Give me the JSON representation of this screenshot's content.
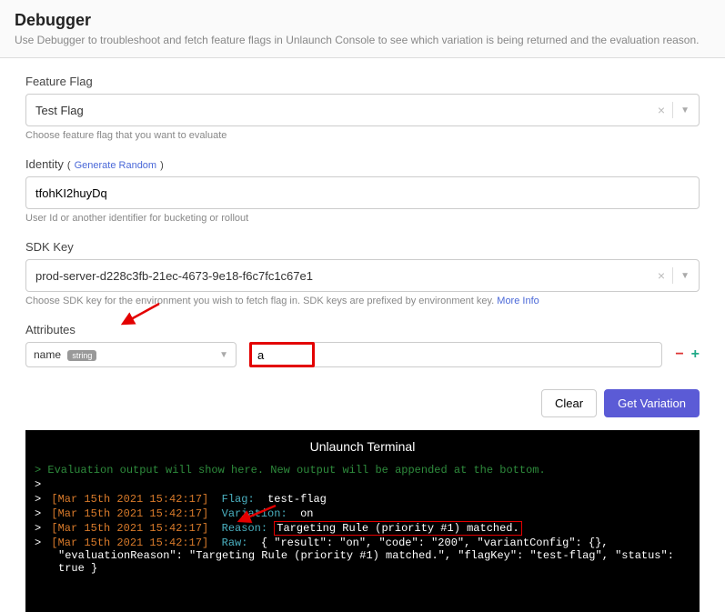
{
  "header": {
    "title": "Debugger",
    "subtitle": "Use Debugger to troubleshoot and fetch feature flags in Unlaunch Console to see which variation is being returned and the evaluation reason."
  },
  "flag": {
    "label": "Feature Flag",
    "value": "Test Flag",
    "help": "Choose feature flag that you want to evaluate"
  },
  "identity": {
    "label": "Identity",
    "generate": "Generate Random",
    "value": "tfohKI2huyDq",
    "help": "User Id or another identifier for bucketing or rollout"
  },
  "sdk": {
    "label": "SDK Key",
    "value": "prod-server-d228c3fb-21ec-4673-9e18-f6c7fc1c67e1",
    "help": "Choose SDK key for the environment you wish to fetch flag in. SDK keys are prefixed by environment key.",
    "more": "More Info"
  },
  "attrs": {
    "label": "Attributes",
    "name": "name",
    "type_badge": "string",
    "value": "a"
  },
  "buttons": {
    "clear": "Clear",
    "get": "Get Variation"
  },
  "terminal": {
    "title": "Unlaunch Terminal",
    "hint": "> Evaluation output will show here. New output will be appended at the bottom.",
    "ts": "[Mar 15th 2021 15:42:17]",
    "flag_label": "Flag:",
    "flag_val": "test-flag",
    "variation_label": "Variation:",
    "variation_val": "on",
    "reason_label": "Reason:",
    "reason_val": "Targeting Rule (priority #1) matched.",
    "raw_label": "Raw:",
    "raw_val": "{ \"result\": \"on\", \"code\": \"200\", \"variantConfig\": {}, \"evaluationReason\": \"Targeting Rule (priority #1) matched.\", \"flagKey\": \"test-flag\", \"status\": true }"
  }
}
